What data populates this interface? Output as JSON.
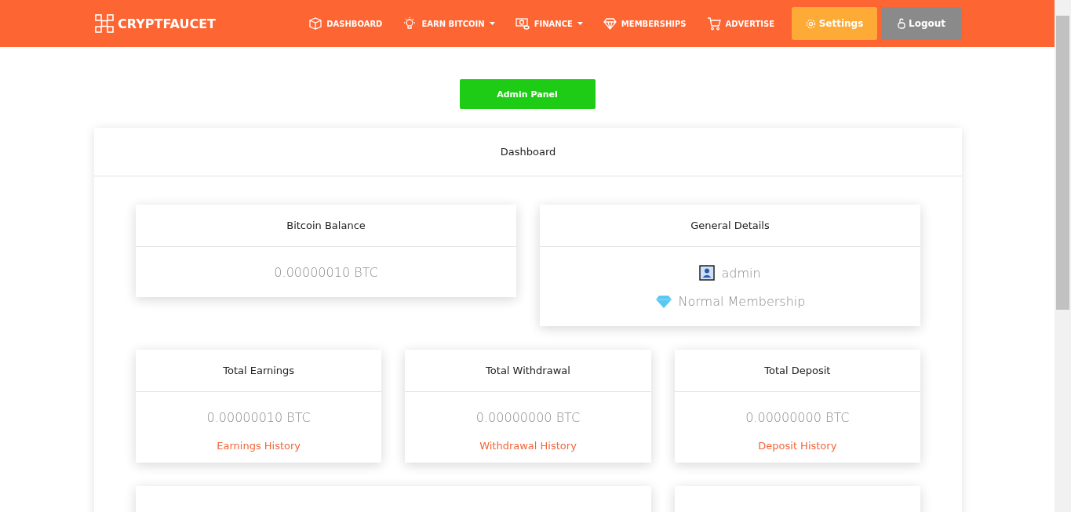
{
  "brand": "CRYPTFAUCET",
  "nav": [
    {
      "label": "DASHBOARD",
      "kind": "cube",
      "dropdown": false
    },
    {
      "label": "EARN BITCOIN",
      "kind": "bulb",
      "dropdown": true
    },
    {
      "label": "FINANCE",
      "kind": "money",
      "dropdown": true
    },
    {
      "label": "MEMBERSHIPS",
      "kind": "diamond",
      "dropdown": false
    },
    {
      "label": "ADVERTISE",
      "kind": "cart",
      "dropdown": false
    }
  ],
  "settings_button": "Settings",
  "logout_button": "Logout",
  "admin_button": "Admin Panel",
  "dashboard": {
    "title": "Dashboard",
    "balance": {
      "title": "Bitcoin Balance",
      "value": "0.00000010 BTC"
    },
    "details": {
      "title": "General Details",
      "username": "admin",
      "membership": "Normal Membership"
    },
    "stats": [
      {
        "title": "Total Earnings",
        "value": "0.00000010 BTC",
        "link": "Earnings History"
      },
      {
        "title": "Total Withdrawal",
        "value": "0.00000000 BTC",
        "link": "Withdrawal History"
      },
      {
        "title": "Total Deposit",
        "value": "0.00000000 BTC",
        "link": "Deposit History"
      }
    ]
  }
}
